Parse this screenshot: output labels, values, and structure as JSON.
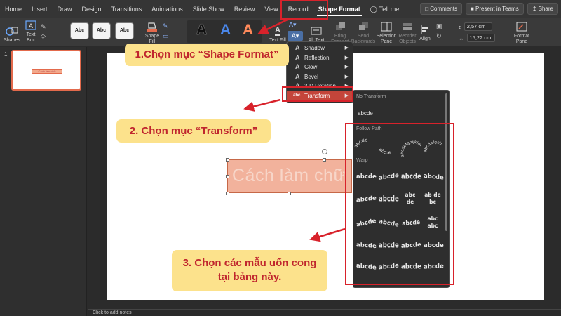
{
  "tabs": [
    "Home",
    "Insert",
    "Draw",
    "Design",
    "Transitions",
    "Animations",
    "Slide Show",
    "Review",
    "View",
    "Record",
    "Shape Format"
  ],
  "active_tab": "Shape Format",
  "tell_me": "Tell me",
  "header_buttons": {
    "comments": "Comments",
    "present": "Present in Teams",
    "share": "Share"
  },
  "ribbon": {
    "shapes": "Shapes",
    "text_box": "Text Box",
    "style_samples": [
      "Abc",
      "Abc",
      "Abc"
    ],
    "shape_fill": "Shape Fill",
    "wordart_letters": [
      "A",
      "A",
      "A"
    ],
    "text_fill": "Text Fill",
    "alt_text": "Alt Text",
    "bring_forward": "Bring Forward",
    "send_backward": "Send Backwards",
    "selection_pane": "Selection Pane",
    "reorder_objects": "Reorder Objects",
    "align": "Align",
    "height": "2,57 cm",
    "width": "15,22 cm",
    "format_pane": "Format Pane"
  },
  "thumbnail": {
    "number": "1",
    "mini_text": "Cách làm chữ"
  },
  "slide": {
    "shape_text": "Cách làm chữ"
  },
  "notes_placeholder": "Click to add notes",
  "text_effects_menu": [
    {
      "icon": "A",
      "label": "Shadow",
      "selected": false
    },
    {
      "icon": "A",
      "label": "Reflection",
      "selected": false
    },
    {
      "icon": "A",
      "label": "Glow",
      "selected": false
    },
    {
      "icon": "A",
      "label": "Bevel",
      "selected": false
    },
    {
      "icon": "A",
      "label": "3-D Rotation",
      "selected": false
    },
    {
      "icon": "abc",
      "label": "Transform",
      "selected": true
    }
  ],
  "transform_gallery": {
    "no_transform_header": "No Transform",
    "no_transform_sample": "abcde",
    "follow_path_header": "Follow Path",
    "warp_header": "Warp",
    "follow_path_samples": [
      "abcde",
      "abcde",
      "abcdefghijklm",
      "abcdefghij"
    ],
    "warp_rows": [
      [
        "abcde",
        "abcde",
        "abcde",
        "abcde"
      ],
      [
        "abcde",
        "abcde",
        "abc de",
        "ab de bc"
      ],
      [
        "abcde",
        "abcde",
        "abcde",
        "abc abc"
      ],
      [
        "abcde",
        "abcde",
        "abcde",
        "abcde"
      ],
      [
        "abcde",
        "abcde",
        "abcde",
        "abcde"
      ]
    ]
  },
  "annotations": {
    "step1": "1.Chọn mục “Shape Format”",
    "step2": "2. Chọn mục “Transform”",
    "step3_line1": "3. Chọn các mẫu uốn cong",
    "step3_line2": "tại bảng này."
  },
  "colors": {
    "annotation_red": "#d8222b",
    "callout_bg": "#fce28c",
    "shape_fill": "#f2b29c",
    "selected_menu": "#c4453a"
  }
}
